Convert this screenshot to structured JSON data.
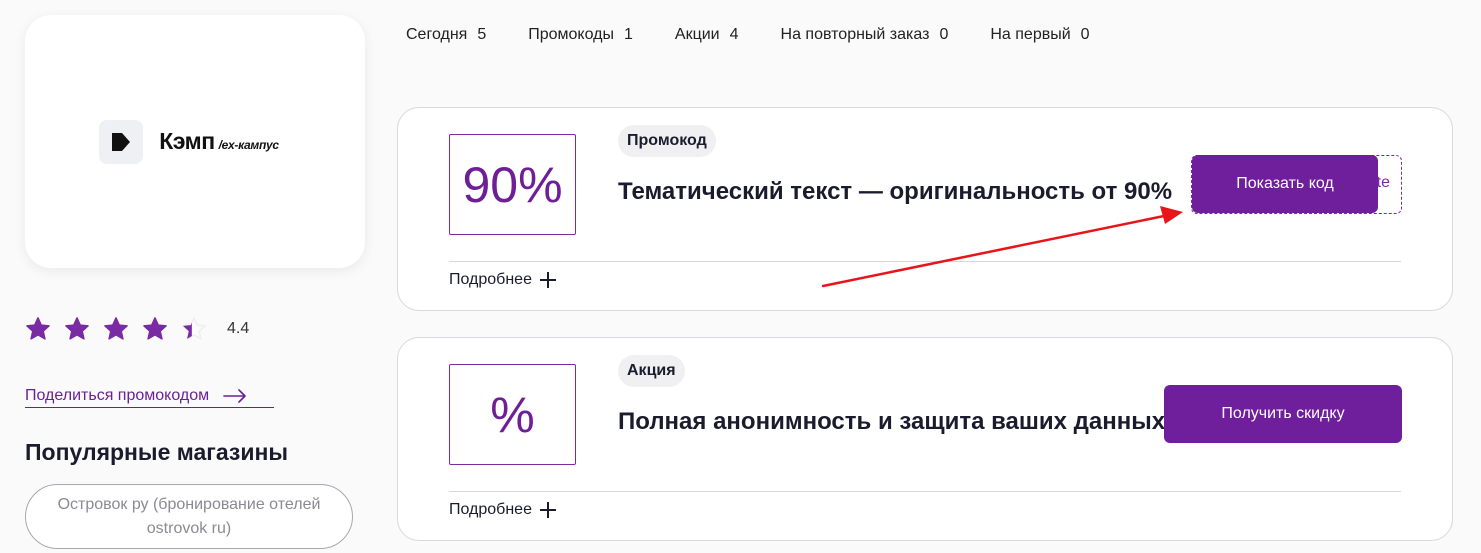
{
  "brand": {
    "name": "Кэмп",
    "subtitle": "/ex-кампус"
  },
  "rating": {
    "value": "4.4",
    "stars_full": 4,
    "stars_partial": 0.4,
    "star_color": "#7a2aa2"
  },
  "share": {
    "label": "Поделиться промокодом",
    "icon": "arrow-right-icon"
  },
  "popular": {
    "title": "Популярные магазины",
    "stores": [
      "Островок ру (бронирование отелей ostrovok ru)"
    ]
  },
  "tabs": [
    {
      "label": "Сегодня",
      "count": "5"
    },
    {
      "label": "Промокоды",
      "count": "1"
    },
    {
      "label": "Акции",
      "count": "4"
    },
    {
      "label": "На повторный заказ",
      "count": "0"
    },
    {
      "label": "На первый",
      "count": "0"
    }
  ],
  "offers": [
    {
      "badge": "90%",
      "tag": "Промокод",
      "title": "Тематический текст — оригинальность от 90%",
      "more": "Подробнее",
      "button": "Показать код",
      "code_peek": "te"
    },
    {
      "badge": "%",
      "tag": "Акция",
      "title": "Полная анонимность и защита ваших данных",
      "more": "Подробнее",
      "button": "Получить скидку"
    }
  ],
  "colors": {
    "accent": "#6f1f9b",
    "annotation_arrow": "#e8141a"
  }
}
